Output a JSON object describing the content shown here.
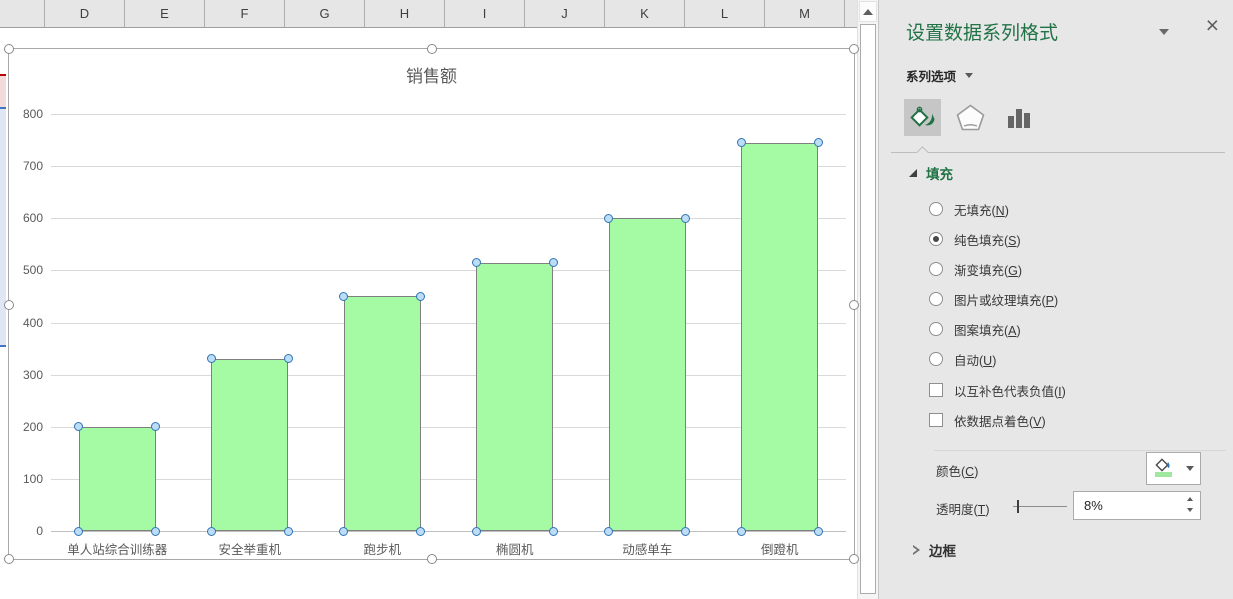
{
  "spreadsheet": {
    "column_headers": [
      "D",
      "E",
      "F",
      "G",
      "H",
      "I",
      "J",
      "K",
      "L",
      "M"
    ]
  },
  "chart_data": {
    "type": "bar",
    "title": "销售额",
    "categories": [
      "单人站综合训练器",
      "安全举重机",
      "跑步机",
      "椭圆机",
      "动感单车",
      "倒蹬机"
    ],
    "values": [
      200,
      330,
      450,
      515,
      600,
      745
    ],
    "ylim": [
      0,
      800
    ],
    "ytick_step": 100,
    "grid": true,
    "legend": "none",
    "bar_fill": "#A4FBA4",
    "bar_border": "#7F7F7F",
    "selection_handle_fill": "#BDDCF5",
    "selection_handle_border": "#2E75B6"
  },
  "background_fragment": {
    "red_line": "#C00000",
    "pink_fill": "#F2DCDB",
    "blue_line": "#4472C4",
    "light_blue_fill": "#DEE7F3"
  },
  "pane": {
    "accent_green": "#217346",
    "title": "设置数据系列格式",
    "close_label": "×",
    "section_label": "系列选项",
    "icons": [
      {
        "name": "fill-and-line",
        "selected": true
      },
      {
        "name": "effects",
        "selected": false
      },
      {
        "name": "series-options",
        "selected": false
      }
    ],
    "fill_section": {
      "header": "填充",
      "options": [
        {
          "label": "无填充(N)",
          "type": "radio",
          "checked": false
        },
        {
          "label": "纯色填充(S)",
          "type": "radio",
          "checked": true
        },
        {
          "label": "渐变填充(G)",
          "type": "radio",
          "checked": false
        },
        {
          "label": "图片或纹理填充(P)",
          "type": "radio",
          "checked": false
        },
        {
          "label": "图案填充(A)",
          "type": "radio",
          "checked": false
        },
        {
          "label": "自动(U)",
          "type": "radio",
          "checked": false
        },
        {
          "label": "以互补色代表负值(I)",
          "type": "checkbox",
          "checked": false
        },
        {
          "label": "依数据点着色(V)",
          "type": "checkbox",
          "checked": false
        }
      ],
      "color_label": "颜色(C)",
      "color_swatch": "#9FE89F",
      "transparency_label": "透明度(T)",
      "transparency_value": "8%"
    },
    "border_section": {
      "header": "边框",
      "expanded": false
    }
  }
}
